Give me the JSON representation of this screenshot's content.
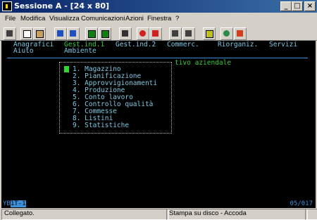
{
  "window": {
    "title": "Sessione A - [24 x 80]",
    "minimize": "_",
    "maximize": "□",
    "close": "×"
  },
  "menubar": [
    {
      "label": "File"
    },
    {
      "label": "Modifica"
    },
    {
      "label": "Visualizza"
    },
    {
      "label": "Comunicazioni"
    },
    {
      "label": "Azioni"
    },
    {
      "label": "Finestra"
    },
    {
      "label": "?"
    }
  ],
  "toolbar": [
    "print-icon",
    "copy-icon",
    "paste-icon",
    "send-icon",
    "receive-icon",
    "display-icon",
    "display2-icon",
    "macro-icon",
    "record-icon",
    "stop-icon",
    "play-icon",
    "play2-icon",
    "clipboard-icon",
    "globe-icon",
    "key-icon"
  ],
  "terminal": {
    "row1": [
      "Anagrafici",
      "Gest.ind.1",
      "Gest.ind.2",
      "Commerc.",
      "Riorganiz.",
      "Servizi"
    ],
    "row2": [
      "Aiuto",
      "Ambiente"
    ],
    "popup_title": "tivo aziendale",
    "menu_items": [
      "1. Magazzino",
      "2. Pianificazione",
      "3. Approvvigionamenti",
      "4. Produzione",
      "5. Conto lavoro",
      "6. Controllo qualità",
      "7. Commesse",
      "8. Listini",
      "9. Statistiche"
    ],
    "status_left_a": "YB",
    "status_left_b": "1T-1",
    "status_right": "05/017"
  },
  "statusbar": {
    "left": "Collegato.",
    "right": "Stampa su disco - Accoda"
  },
  "colors": {
    "menu_text": "#7ec8e3",
    "highlight": "#3ec93e",
    "accent_blue": "#3a8fd8"
  }
}
